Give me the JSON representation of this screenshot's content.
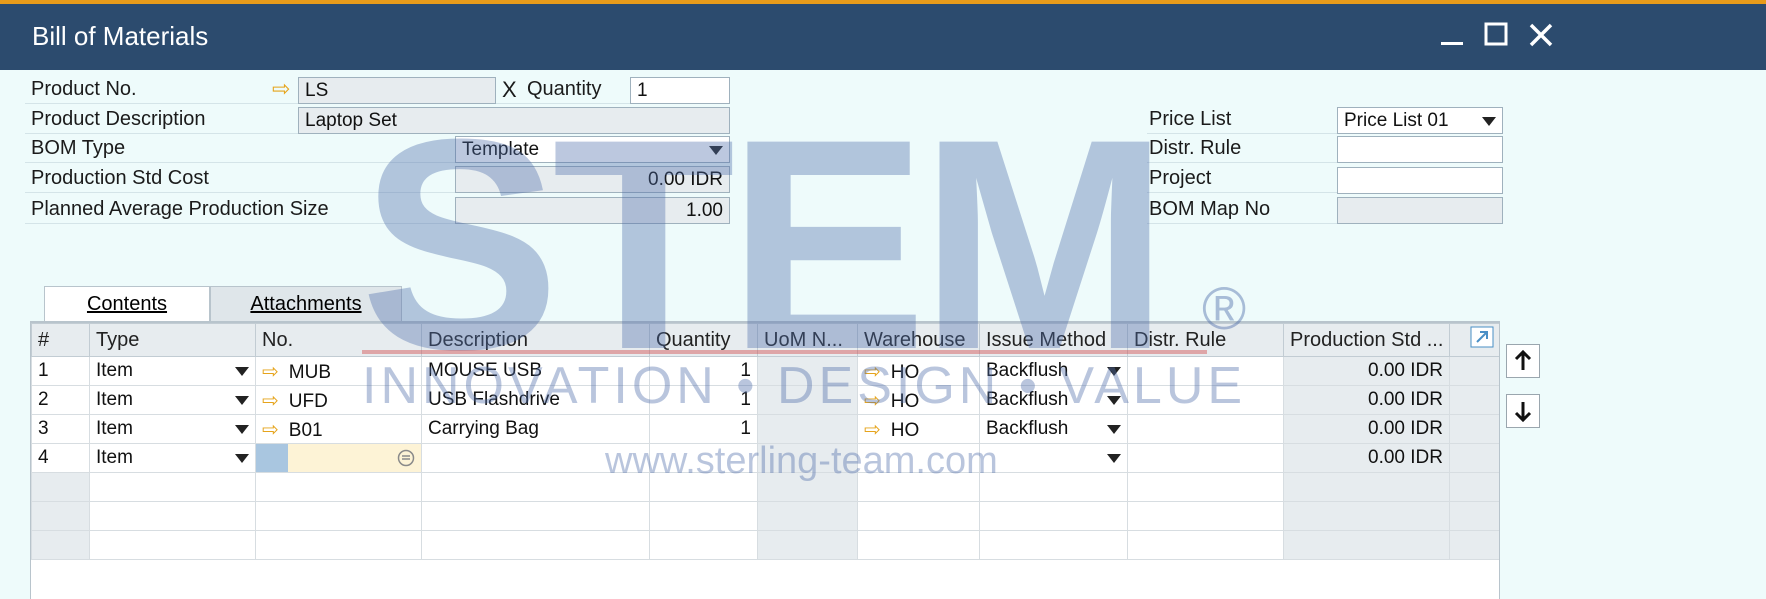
{
  "window": {
    "title": "Bill of Materials"
  },
  "header": {
    "product_no_label": "Product No.",
    "product_no": "LS",
    "x_label": "X",
    "quantity_label": "Quantity",
    "quantity": "1",
    "product_desc_label": "Product Description",
    "product_desc": "Laptop Set",
    "bom_type_label": "BOM Type",
    "bom_type": "Template",
    "prod_std_cost_label": "Production Std Cost",
    "prod_std_cost": "0.00 IDR",
    "planned_avg_label": "Planned Average Production Size",
    "planned_avg": "1.00",
    "price_list_label": "Price List",
    "price_list": "Price List 01",
    "distr_rule_label": "Distr. Rule",
    "distr_rule": "",
    "project_label": "Project",
    "project": "",
    "bom_map_label": "BOM Map No",
    "bom_map": ""
  },
  "tabs": [
    {
      "label": "Contents"
    },
    {
      "label": "Attachments"
    }
  ],
  "table": {
    "columns": [
      "#",
      "Type",
      "No.",
      "Description",
      "Quantity",
      "UoM N...",
      "Warehouse",
      "Issue Method",
      "Distr. Rule",
      "Production Std ..."
    ],
    "rows": [
      {
        "num": "1",
        "type": "Item",
        "no": "MUB",
        "desc": "MOUSE USB",
        "qty": "1",
        "uom": "",
        "wh": "HO",
        "issue": "Backflush",
        "distr": "",
        "cost": "0.00 IDR"
      },
      {
        "num": "2",
        "type": "Item",
        "no": "UFD",
        "desc": "USB Flashdrive",
        "qty": "1",
        "uom": "",
        "wh": "HO",
        "issue": "Backflush",
        "distr": "",
        "cost": "0.00 IDR"
      },
      {
        "num": "3",
        "type": "Item",
        "no": "B01",
        "desc": "Carrying Bag",
        "qty": "1",
        "uom": "",
        "wh": "HO",
        "issue": "Backflush",
        "distr": "",
        "cost": "0.00 IDR"
      },
      {
        "num": "4",
        "type": "Item",
        "no": "",
        "desc": "",
        "qty": "",
        "uom": "",
        "wh": "",
        "issue": "",
        "distr": "",
        "cost": "0.00 IDR"
      }
    ]
  },
  "watermark": {
    "logo": "STEM",
    "registered": "®",
    "tagline": "INNOVATION • DESIGN • VALUE",
    "url": "www.sterling-team.com"
  }
}
